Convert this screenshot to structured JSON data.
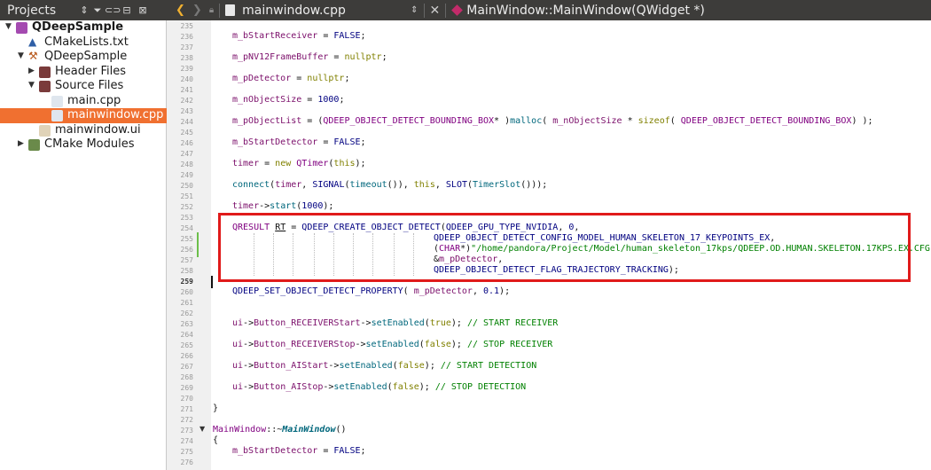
{
  "left_pane": {
    "title": "Projects",
    "tree": [
      {
        "label": "QDeepSample",
        "level": 0,
        "expanded": true,
        "icon": "qt-project-icon",
        "root": true
      },
      {
        "label": "CMakeLists.txt",
        "level": 1,
        "icon": "cmake-file-icon"
      },
      {
        "label": "QDeepSample",
        "level": 1,
        "expanded": true,
        "icon": "hammer-icon"
      },
      {
        "label": "Header Files",
        "level": 2,
        "expanded": false,
        "icon": "folder-icon"
      },
      {
        "label": "Source Files",
        "level": 2,
        "expanded": true,
        "icon": "folder-icon"
      },
      {
        "label": "main.cpp",
        "level": 3,
        "icon": "cpp-file-icon"
      },
      {
        "label": "mainwindow.cpp",
        "level": 3,
        "icon": "cpp-file-icon",
        "selected": true
      },
      {
        "label": "mainwindow.ui",
        "level": 2,
        "icon": "ui-file-icon"
      },
      {
        "label": "CMake Modules",
        "level": 1,
        "expanded": false,
        "icon": "cmake-folder-icon"
      }
    ]
  },
  "editor": {
    "file_name": "mainwindow.cpp",
    "function_name": "MainWindow::MainWindow(QWidget *)",
    "current_line": "259",
    "line_numbers": [
      "235",
      "236",
      "237",
      "238",
      "239",
      "240",
      "241",
      "242",
      "243",
      "244",
      "245",
      "246",
      "247",
      "248",
      "249",
      "250",
      "251",
      "252",
      "253",
      "254",
      "255",
      "256",
      "257",
      "258",
      "259",
      "260",
      "261",
      "262",
      "263",
      "264",
      "265",
      "266",
      "267",
      "268",
      "269",
      "270",
      "271",
      "272",
      "273",
      "274",
      "275",
      "276"
    ]
  },
  "colors": {
    "selection": "#f07030",
    "highlight_box": "#e01a1a",
    "titlebar": "#3d3c3a"
  }
}
